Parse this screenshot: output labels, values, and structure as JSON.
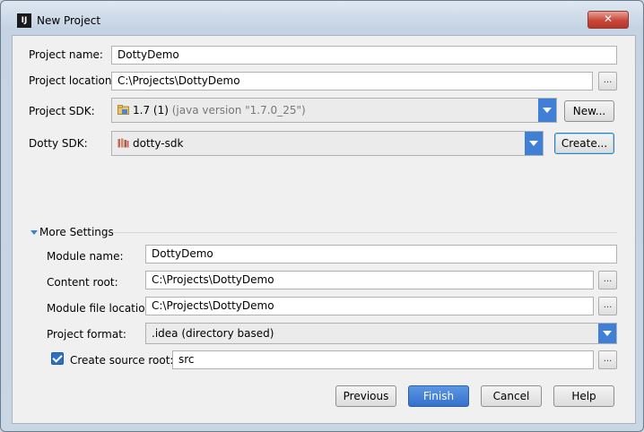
{
  "window": {
    "title": "New Project",
    "app_icon_text": "IJ",
    "close_glyph": "✕"
  },
  "project": {
    "name_label": "Project name:",
    "name_value": "DottyDemo",
    "location_label": "Project location:",
    "location_value": "C:\\Projects\\DottyDemo",
    "sdk_label": "Project SDK:",
    "sdk_version": "1.7 (1)",
    "sdk_detail": "(java version \"1.7.0_25\")",
    "sdk_new_button": "New...",
    "dotty_label": "Dotty SDK:",
    "dotty_value": "dotty-sdk",
    "dotty_create_button": "Create..."
  },
  "more_settings": {
    "title": "More Settings",
    "module_name_label": "Module name:",
    "module_name_value": "DottyDemo",
    "content_root_label": "Content root:",
    "content_root_value": "C:\\Projects\\DottyDemo",
    "module_file_label": "Module file location:",
    "module_file_value": "C:\\Projects\\DottyDemo",
    "format_label": "Project format:",
    "format_value": ".idea (directory based)",
    "source_root_label": "Create source root:",
    "source_root_checked": true,
    "source_root_value": "src"
  },
  "browse_glyph": "...",
  "buttons": {
    "previous": "Previous",
    "finish": "Finish",
    "cancel": "Cancel",
    "help": "Help"
  },
  "colors": {
    "accent": "#3f7fd6",
    "primary_button": "#3570cc",
    "close_button": "#c9473a"
  }
}
